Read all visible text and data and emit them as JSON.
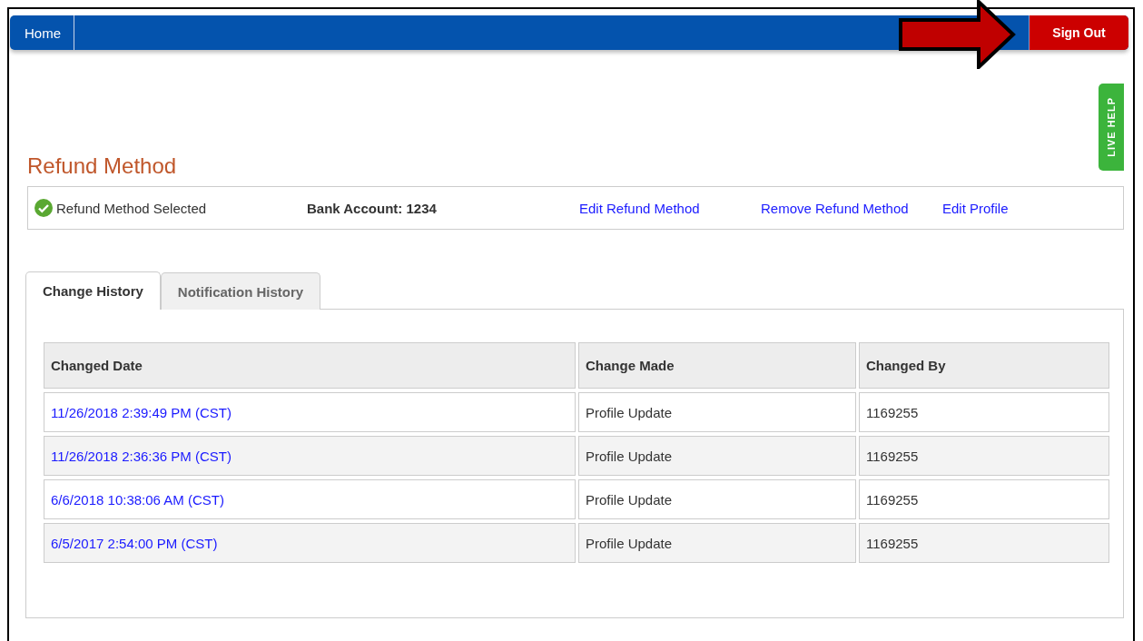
{
  "nav": {
    "home": "Home",
    "sign_out": "Sign Out"
  },
  "live_help": "LIVE HELP",
  "title": "Refund Method",
  "summary": {
    "status": "Refund Method Selected",
    "account": "Bank Account: 1234",
    "links": [
      "Edit Refund Method",
      "Remove Refund Method",
      "Edit Profile"
    ]
  },
  "tabs": [
    {
      "label": "Change History",
      "selected": true
    },
    {
      "label": "Notification History",
      "selected": false
    }
  ],
  "table": {
    "columns": [
      "Changed Date",
      "Change Made",
      "Changed By"
    ],
    "rows": [
      [
        "11/26/2018 2:39:49 PM (CST)",
        "Profile Update",
        "1169255"
      ],
      [
        "11/26/2018 2:36:36 PM (CST)",
        "Profile Update",
        "1169255"
      ],
      [
        "6/6/2018 10:38:06 AM (CST)",
        "Profile Update",
        "1169255"
      ],
      [
        "6/5/2017 2:54:00 PM (CST)",
        "Profile Update",
        "1169255"
      ]
    ]
  }
}
